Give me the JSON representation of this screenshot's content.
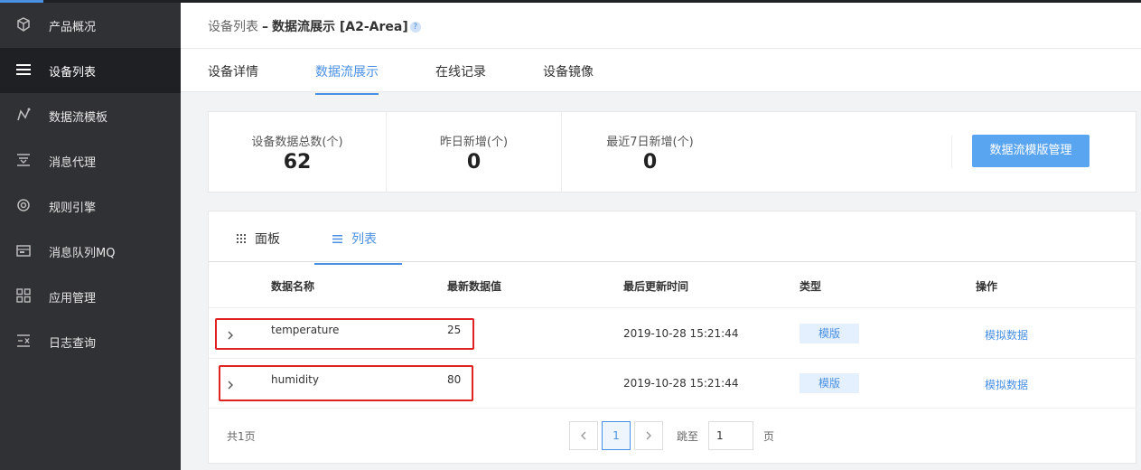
{
  "sidebar": {
    "items": [
      {
        "label": "产品概况",
        "icon": "cube-icon",
        "active": false
      },
      {
        "label": "设备列表",
        "icon": "menu-icon",
        "active": true
      },
      {
        "label": "数据流模板",
        "icon": "dataflow-icon",
        "active": false
      },
      {
        "label": "消息代理",
        "icon": "message-proxy-icon",
        "active": false
      },
      {
        "label": "规则引擎",
        "icon": "rule-engine-icon",
        "active": false
      },
      {
        "label": "消息队列MQ",
        "icon": "queue-icon",
        "active": false
      },
      {
        "label": "应用管理",
        "icon": "grid-icon",
        "active": false
      },
      {
        "label": "日志查询",
        "icon": "log-icon",
        "active": false
      }
    ]
  },
  "breadcrumb": {
    "parent": "设备列表",
    "separator": "–",
    "current": "数据流展示 [A2-Area]"
  },
  "tabs": [
    "设备详情",
    "数据流展示",
    "在线记录",
    "设备镜像"
  ],
  "stats": [
    {
      "label": "设备数据总数(个)",
      "value": "62"
    },
    {
      "label": "昨日新增(个)",
      "value": "0"
    },
    {
      "label": "最近7日新增(个)",
      "value": "0"
    }
  ],
  "manage_button": "数据流模版管理",
  "subtabs": [
    {
      "label": "面板",
      "icon": "grid-dots-icon",
      "active": false
    },
    {
      "label": "列表",
      "icon": "list-icon",
      "active": true
    }
  ],
  "table": {
    "columns": [
      "数据名称",
      "最新数据值",
      "最后更新时间",
      "类型",
      "操作"
    ],
    "rows": [
      {
        "name": "temperature",
        "value": "25",
        "time": "2019-10-28 15:21:44",
        "type": "模版",
        "action": "模拟数据"
      },
      {
        "name": "humidity",
        "value": "80",
        "time": "2019-10-28 15:21:44",
        "type": "模版",
        "action": "模拟数据"
      }
    ]
  },
  "pagination": {
    "total": "共1页",
    "current_page": "1",
    "jump_label": "跳至",
    "jump_value": "1",
    "page_suffix": "页"
  },
  "colors": {
    "accent": "#4a90e2",
    "sidebar_bg": "#303135",
    "highlight": "#e02222"
  }
}
